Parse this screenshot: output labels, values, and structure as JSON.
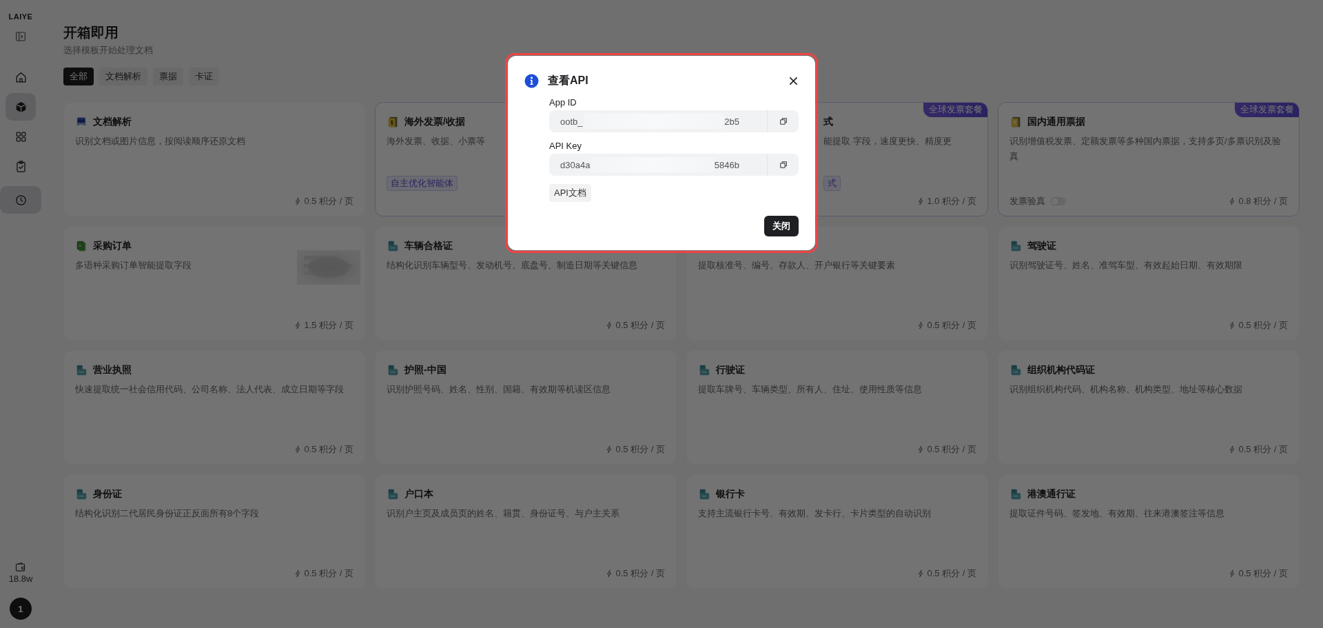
{
  "sidebar": {
    "logo": "LAIYE",
    "items": [
      {
        "kind": "home",
        "selected": false
      },
      {
        "kind": "cube",
        "selected": true
      },
      {
        "kind": "grid",
        "selected": false
      },
      {
        "kind": "clipboard",
        "selected": false
      },
      {
        "kind": "clock",
        "selected": true
      }
    ],
    "credits": "18.8w",
    "avatar": "1"
  },
  "page": {
    "title": "开箱即用",
    "subtitle": "选择模板开始处理文档"
  },
  "filters": [
    {
      "label": "全部",
      "selected": true
    },
    {
      "label": "文档解析",
      "selected": false
    },
    {
      "label": "票据",
      "selected": false
    },
    {
      "label": "卡证",
      "selected": false
    }
  ],
  "cards": [
    {
      "kind": "document",
      "title": "文档解析",
      "description": "识别文档或图片信息，按阅读顺序还原文档",
      "price": "0.5 积分 / 页",
      "highlighted": false
    },
    {
      "kind": "invoice",
      "title": "海外发票/收据",
      "description": "海外发票、收据、小票等",
      "tag": "自主优化智能体",
      "highlighted": true
    },
    {
      "kind": "invoice",
      "partly_hidden": true,
      "title": "式",
      "description": "能提取 字段，速度更快、精度更",
      "tag": "式",
      "badge": "全球发票套餐",
      "price": "1.0 积分 / 页",
      "highlighted": true
    },
    {
      "kind": "receipt",
      "title": "国内通用票据",
      "description": "识别增值税发票、定额发票等多种国内票据，支持多页/多票识别及验真",
      "badge": "全球发票套餐",
      "toggle": {
        "label": "发票验真",
        "on": false
      },
      "price": "0.8 积分 / 页",
      "highlighted": true
    },
    {
      "kind": "order",
      "title": "采购订单",
      "description": "多语种采购订单智能提取字段",
      "price": "1.5 积分 / 页",
      "highlighted": false
    },
    {
      "kind": "certificate",
      "title": "车辆合格证",
      "description": "结构化识别车辆型号、发动机号、底盘号、制造日期等关键信息",
      "price": "0.5 积分 / 页",
      "highlighted": false
    },
    {
      "description": "提取核准号、编号、存款人、开户银行等关键要素",
      "price": "0.5 积分 / 页",
      "highlighted": false
    },
    {
      "kind": "certificate",
      "title": "驾驶证",
      "description": "识别驾驶证号、姓名、准驾车型、有效起始日期、有效期限",
      "price": "0.5 积分 / 页",
      "highlighted": false
    },
    {
      "kind": "certificate",
      "title": "营业执照",
      "description": "快速提取统一社会信用代码、公司名称、法人代表、成立日期等字段",
      "price": "0.5 积分 / 页",
      "highlighted": false
    },
    {
      "kind": "certificate",
      "title": "护照-中国",
      "description": "识别护照号码、姓名、性别、国籍、有效期等机读区信息",
      "price": "0.5 积分 / 页",
      "highlighted": false
    },
    {
      "kind": "certificate",
      "title": "行驶证",
      "description": "提取车牌号、车辆类型、所有人、住址、使用性质等信息",
      "price": "0.5 积分 / 页",
      "highlighted": false
    },
    {
      "kind": "certificate",
      "title": "组织机构代码证",
      "description": "识别组织机构代码、机构名称、机构类型、地址等核心数据",
      "price": "0.5 积分 / 页",
      "highlighted": false
    },
    {
      "kind": "certificate",
      "title": "身份证",
      "description": "结构化识别二代居民身份证正反面所有8个字段",
      "price": "0.5 积分 / 页",
      "highlighted": false
    },
    {
      "kind": "certificate",
      "title": "户口本",
      "description": "识别户主页及成员页的姓名、籍贯、身份证号、与户主关系",
      "price": "0.5 积分 / 页",
      "highlighted": false
    },
    {
      "kind": "certificate",
      "title": "银行卡",
      "description": "支持主流银行卡号、有效期、发卡行、卡片类型的自动识别",
      "price": "0.5 积分 / 页",
      "highlighted": false
    },
    {
      "kind": "certificate",
      "title": "港澳通行证",
      "description": "提取证件号码、签发地、有效期、往来港澳签注等信息",
      "price": "0.5 积分 / 页",
      "highlighted": false
    }
  ],
  "modal": {
    "title": "查看API",
    "highlighted": true,
    "fields": [
      {
        "label": "App ID",
        "value_start": "ootb_",
        "value_end": "2b5"
      },
      {
        "label": "API Key",
        "value_start": "d30a4a",
        "value_end": "5846b"
      }
    ],
    "doc_button": "API文档",
    "close_button": "关闭"
  }
}
